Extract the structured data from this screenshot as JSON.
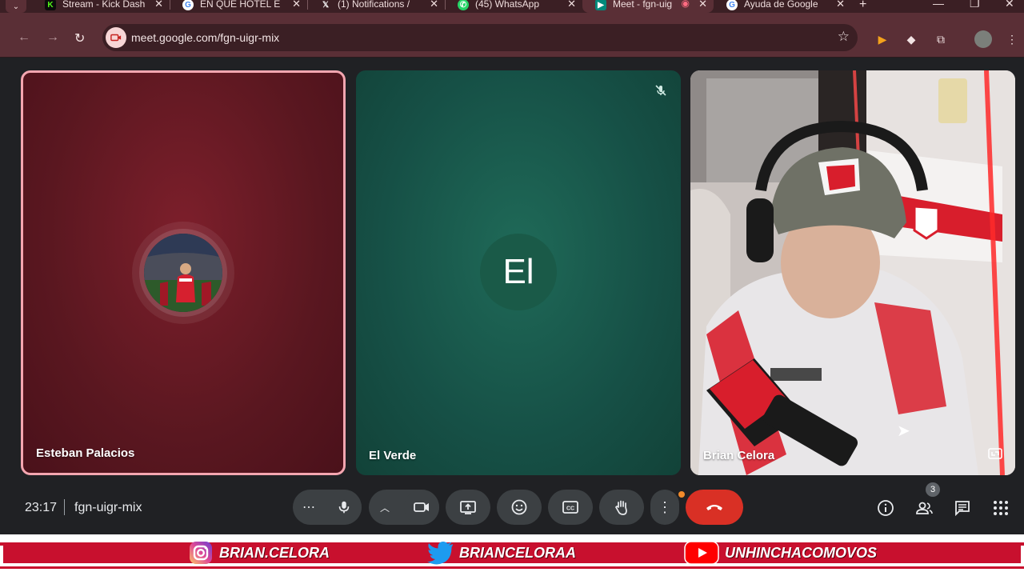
{
  "browser": {
    "tabs": [
      {
        "label": "Stream - Kick Dash",
        "favicon": "kick-icon",
        "color": "#53fc18"
      },
      {
        "label": "EN QUE HOTEL ES",
        "favicon": "google-icon",
        "color": "#4285f4"
      },
      {
        "label": "(1) Notifications / ",
        "favicon": "x-icon",
        "color": "#000000"
      },
      {
        "label": "(45) WhatsApp",
        "favicon": "whatsapp-icon",
        "color": "#25d366"
      },
      {
        "label": "Meet - fgn-uig",
        "favicon": "meet-icon",
        "color": "#00897b",
        "active": true
      },
      {
        "label": "Ayuda de Google ",
        "favicon": "google-icon",
        "color": "#4285f4"
      }
    ],
    "url": "meet.google.com/fgn-uigr-mix"
  },
  "participants": [
    {
      "name": "Esteban Palacios",
      "type": "photo-avatar",
      "speaking": true
    },
    {
      "name": "El Verde",
      "type": "initials",
      "initials": "El",
      "muted": true
    },
    {
      "name": "Brian Celora",
      "type": "video"
    }
  ],
  "meeting": {
    "time": "23:17",
    "code": "fgn-uigr-mix",
    "people_count": "3"
  },
  "banner": {
    "instagram": "BRIAN.CELORA",
    "twitter": "BRIANCELORAA",
    "youtube": "UNHINCHACOMOVOS"
  },
  "colors": {
    "accent_red": "#c8102e",
    "hangup": "#d93025",
    "tile_esteban": "#5a1720",
    "tile_elverde": "#165046",
    "browser_frame": "#5a2f36"
  }
}
